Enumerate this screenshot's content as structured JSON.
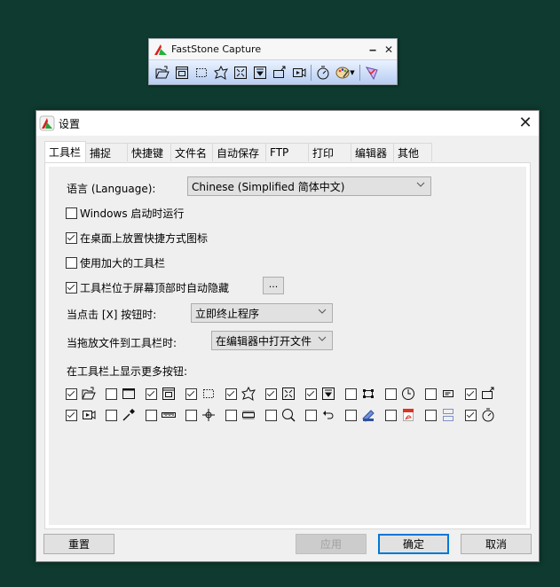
{
  "capture_toolbar": {
    "title": "FastStone Capture",
    "minimize_icon": "minimize-icon",
    "close_icon": "close-icon",
    "tools": [
      {
        "name": "open-file-icon"
      },
      {
        "name": "capture-window-icon"
      },
      {
        "name": "capture-rectangle-icon"
      },
      {
        "name": "capture-freehand-icon"
      },
      {
        "name": "capture-fullscreen-icon"
      },
      {
        "name": "capture-scrolling-icon"
      },
      {
        "name": "capture-fixed-region-icon"
      },
      {
        "name": "screen-recorder-icon"
      },
      {
        "name": "delay-timer-icon"
      },
      {
        "name": "output-palette-icon"
      },
      {
        "name": "settings-menu-icon"
      }
    ]
  },
  "dialog": {
    "title": "设置",
    "tabs": [
      {
        "label": "工具栏",
        "active": true
      },
      {
        "label": "捕捉",
        "active": false
      },
      {
        "label": "快捷键",
        "active": false
      },
      {
        "label": "文件名",
        "active": false
      },
      {
        "label": "自动保存",
        "active": false
      },
      {
        "label": "FTP",
        "active": false
      },
      {
        "label": "打印",
        "active": false
      },
      {
        "label": "编辑器",
        "active": false
      },
      {
        "label": "其他",
        "active": false
      }
    ],
    "language": {
      "label": "语言 (Language):",
      "value": "Chinese (Simplified 简体中文)"
    },
    "options": [
      {
        "label": "Windows 启动时运行",
        "checked": false
      },
      {
        "label": "在桌面上放置快捷方式图标",
        "checked": true
      },
      {
        "label": "使用加大的工具栏",
        "checked": false
      },
      {
        "label": "工具栏位于屏幕顶部时自动隐藏",
        "checked": true
      }
    ],
    "autohide_options_button": "...",
    "on_close": {
      "label": "当点击 [X] 按钮时:",
      "value": "立即终止程序"
    },
    "on_drop": {
      "label": "当拖放文件到工具栏时:",
      "value": "在编辑器中打开文件"
    },
    "more_buttons_label": "在工具栏上显示更多按钮:",
    "more_buttons": [
      [
        {
          "icon": "open-file-icon",
          "checked": true
        },
        {
          "icon": "capture-active-window-icon",
          "checked": false
        },
        {
          "icon": "capture-window-object-icon",
          "checked": true
        },
        {
          "icon": "capture-rectangle-icon",
          "checked": true
        },
        {
          "icon": "capture-freehand-icon",
          "checked": true
        },
        {
          "icon": "capture-fullscreen-icon",
          "checked": true
        },
        {
          "icon": "capture-scrolling-icon",
          "checked": true
        },
        {
          "icon": "capture-fixed-region-icon",
          "checked": false
        },
        {
          "icon": "clock-icon",
          "checked": false
        },
        {
          "icon": "caption-icon",
          "checked": false
        },
        {
          "icon": "capture-to-new-icon",
          "checked": true
        }
      ],
      [
        {
          "icon": "screen-recorder-icon",
          "checked": true
        },
        {
          "icon": "color-picker-icon",
          "checked": false
        },
        {
          "icon": "ruler-icon",
          "checked": false
        },
        {
          "icon": "crosshair-icon",
          "checked": false
        },
        {
          "icon": "screen-bar-icon",
          "checked": false
        },
        {
          "icon": "magnifier-icon",
          "checked": false
        },
        {
          "icon": "undo-icon",
          "checked": false
        },
        {
          "icon": "scanner-icon",
          "checked": false
        },
        {
          "icon": "pdf-icon",
          "checked": false
        },
        {
          "icon": "merge-images-icon",
          "checked": false
        },
        {
          "icon": "delay-timer-icon",
          "checked": true
        }
      ]
    ],
    "buttons": {
      "reset": "重置",
      "apply": "应用",
      "ok": "确定",
      "cancel": "取消"
    }
  }
}
